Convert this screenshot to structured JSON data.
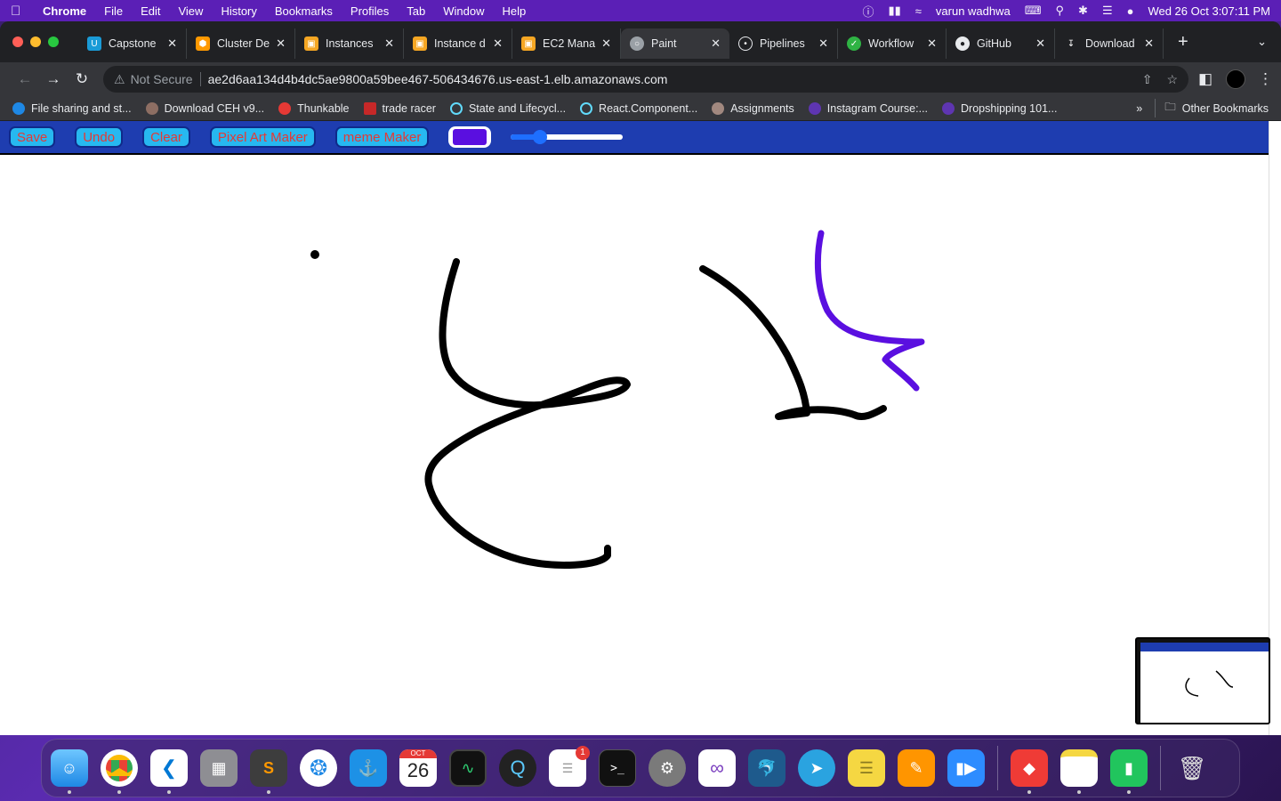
{
  "menubar": {
    "app": "Chrome",
    "items": [
      "File",
      "Edit",
      "View",
      "History",
      "Bookmarks",
      "Profiles",
      "Tab",
      "Window",
      "Help"
    ],
    "user": "varun wadhwa",
    "datetime": "Wed 26 Oct  3:07:11 PM"
  },
  "tabs": [
    {
      "label": "Capstone",
      "color": "#1a9bd7",
      "icon": "capstone-icon"
    },
    {
      "label": "Cluster De",
      "color": "#ff9900",
      "icon": "aws-icon"
    },
    {
      "label": "Instances",
      "color": "#f5a623",
      "icon": "aws-box-icon"
    },
    {
      "label": "Instance d",
      "color": "#f5a623",
      "icon": "aws-box-icon"
    },
    {
      "label": "EC2 Mana",
      "color": "#f5a623",
      "icon": "aws-box-icon"
    },
    {
      "label": "Paint",
      "color": "#9aa0a6",
      "icon": "globe-icon",
      "active": true
    },
    {
      "label": "Pipelines",
      "color": "#e8eaed",
      "icon": "pipeline-icon"
    },
    {
      "label": "Workflow",
      "color": "#2fb344",
      "icon": "workflow-icon"
    },
    {
      "label": "GitHub",
      "color": "#e8eaed",
      "icon": "github-icon"
    },
    {
      "label": "Download",
      "color": "#e8eaed",
      "icon": "download-icon"
    }
  ],
  "omnibox": {
    "security": "Not Secure",
    "url": "ae2d6aa134d4b4dc5ae9800a59bee467-506434676.us-east-1.elb.amazonaws.com"
  },
  "bookmarks": [
    {
      "label": "File sharing and st...",
      "color": "#1e88e5"
    },
    {
      "label": "Download CEH v9...",
      "color": "#8d6e63"
    },
    {
      "label": "Thunkable",
      "color": "#e53935"
    },
    {
      "label": "trade racer",
      "color": "#c62828"
    },
    {
      "label": "State and Lifecycl...",
      "color": "#61dafb"
    },
    {
      "label": "React.Component...",
      "color": "#61dafb"
    },
    {
      "label": "Assignments",
      "color": "#a1887f"
    },
    {
      "label": "Instagram Course:...",
      "color": "#5e35b1"
    },
    {
      "label": "Dropshipping 101...",
      "color": "#5e35b1"
    }
  ],
  "bookmarks_more": "»",
  "bookmarks_other": "Other Bookmarks",
  "paint": {
    "buttons": [
      "Save",
      "Undo",
      "Clear",
      "Pixel Art Maker",
      "meme Maker"
    ],
    "brush_color": "#5a0fe0",
    "brush_size_fraction": 0.22
  },
  "dock": {
    "apps": [
      "finder-icon",
      "chrome-icon",
      "vscode-icon",
      "launchpad-icon",
      "sublime-icon",
      "safari-icon",
      "docker-icon",
      "calendar-icon",
      "activity-monitor-icon",
      "quicktime-icon",
      "reminders-icon",
      "terminal-icon",
      "system-preferences-icon",
      "visual-studio-icon",
      "mysql-workbench-icon",
      "telegram-icon",
      "stickies-icon",
      "pages-icon",
      "zoom-icon",
      "anydesk-icon",
      "notes-icon",
      "numbers-icon",
      "trash-icon"
    ],
    "calendar_month": "OCT",
    "calendar_day": "26",
    "reminders_badge": "1"
  }
}
